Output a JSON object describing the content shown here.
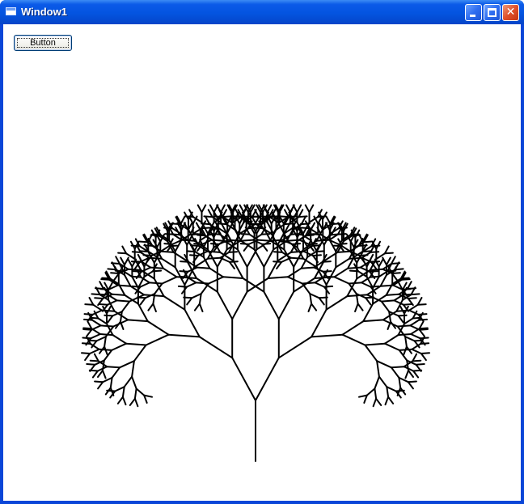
{
  "window": {
    "title": "Window1",
    "icon": "window-app-icon",
    "controls": [
      {
        "name": "minimize",
        "icon": "minimize-icon"
      },
      {
        "name": "maximize",
        "icon": "maximize-icon"
      },
      {
        "name": "close",
        "icon": "close-icon"
      }
    ]
  },
  "content": {
    "button_label": "Button",
    "drawing": {
      "kind": "fractal-tree",
      "stroke_color": "#000000"
    }
  },
  "colors": {
    "titlebar": "#0454e0",
    "close_button": "#e0502a",
    "client_background": "#ffffff"
  }
}
